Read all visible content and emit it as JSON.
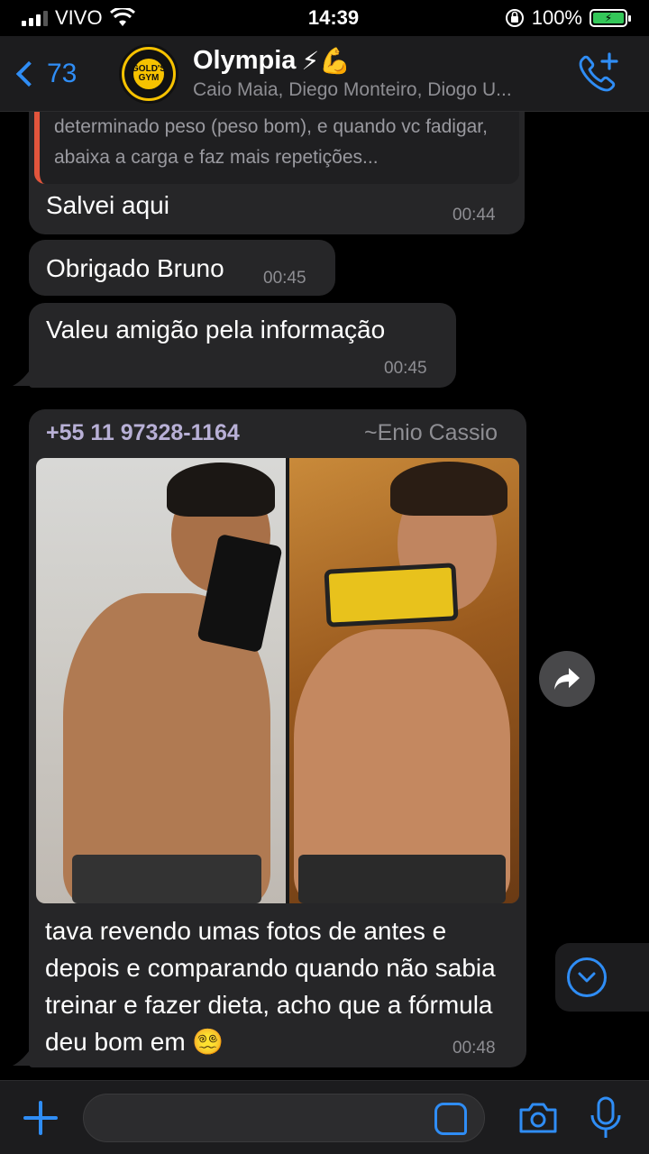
{
  "status": {
    "carrier": "VIVO",
    "time": "14:39",
    "battery": "100%"
  },
  "header": {
    "back_count": "73",
    "title": "Olympia",
    "title_emojis": "⚡💪",
    "subtitle": "Caio Maia, Diego Monteiro, Diogo U...",
    "avatar_text": "GOLD'S GYM"
  },
  "messages": {
    "quote_text": "determinado peso (peso bom), e quando vc fadigar, abaixa a carga e faz mais repetições...",
    "m1_text": "Salvei aqui",
    "m1_time": "00:44",
    "m2_text": "Obrigado Bruno",
    "m2_time": "00:45",
    "m3_text": "Valeu amigão pela informação",
    "m3_time": "00:45",
    "m4_sender": "+55 11 97328-1164",
    "m4_sender_name": "~Enio Cassio",
    "m4_text": "tava revendo umas fotos de antes e depois e comparando quando não sabia treinar e fazer dieta, acho que a fórmula deu bom em 😵‍💫",
    "m4_time": "00:48"
  },
  "input": {
    "placeholder": ""
  },
  "colors": {
    "accent": "#2f8df5",
    "bubble": "#262628",
    "quote_bar": "#e2553c",
    "sender": "#b8b0d6"
  }
}
